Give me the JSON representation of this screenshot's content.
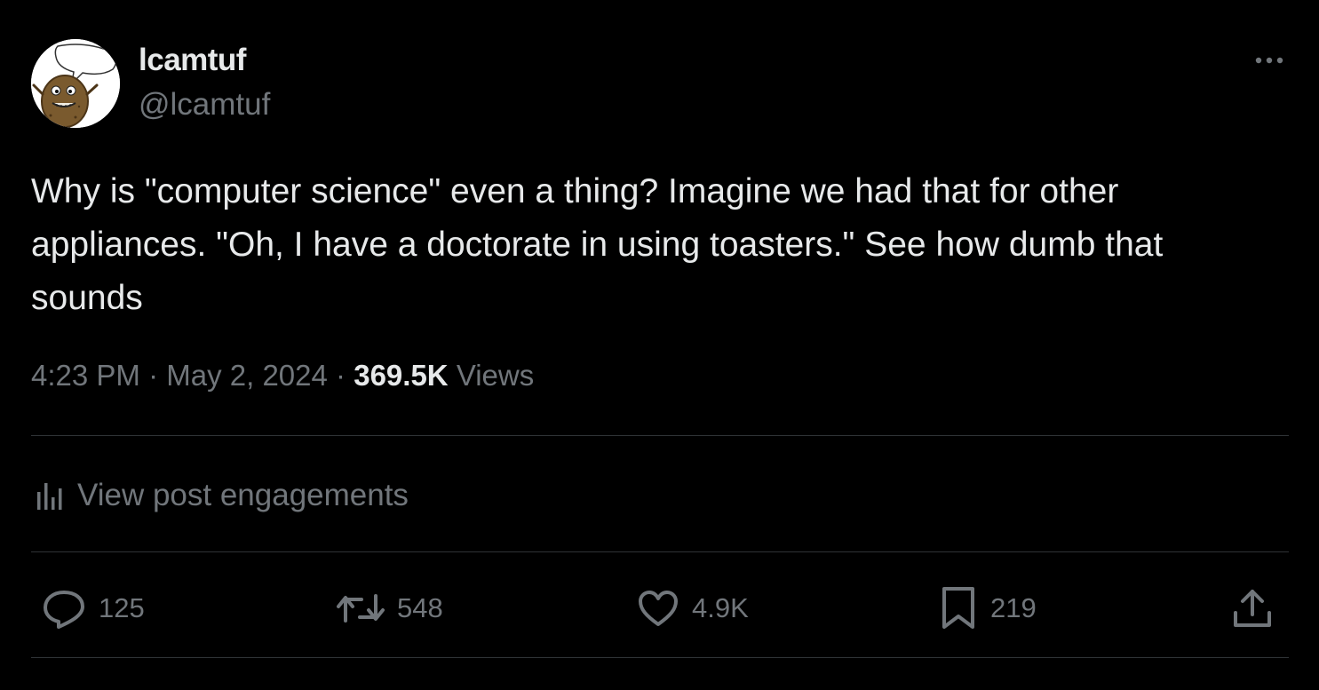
{
  "author": {
    "display_name": "lcamtuf",
    "handle": "@lcamtuf"
  },
  "post": {
    "text": "Why is \"computer science\" even a thing? Imagine we had that for other appliances. \"Oh, I have a doctorate in using toasters.\" See how dumb that sounds",
    "time": "4:23 PM",
    "date": "May 2, 2024",
    "separator": "·",
    "views_count": "369.5K",
    "views_label": "Views"
  },
  "engagements": {
    "label": "View post engagements",
    "icon": "bar-chart-icon"
  },
  "actions": {
    "reply": {
      "count": "125",
      "icon": "reply-icon"
    },
    "repost": {
      "count": "548",
      "icon": "repost-icon"
    },
    "like": {
      "count": "4.9K",
      "icon": "heart-icon"
    },
    "bookmark": {
      "count": "219",
      "icon": "bookmark-icon"
    },
    "share": {
      "icon": "share-icon"
    }
  },
  "colors": {
    "background": "#000000",
    "text_primary": "#e7e9ea",
    "text_secondary": "#71767b",
    "divider": "#2f3336"
  }
}
